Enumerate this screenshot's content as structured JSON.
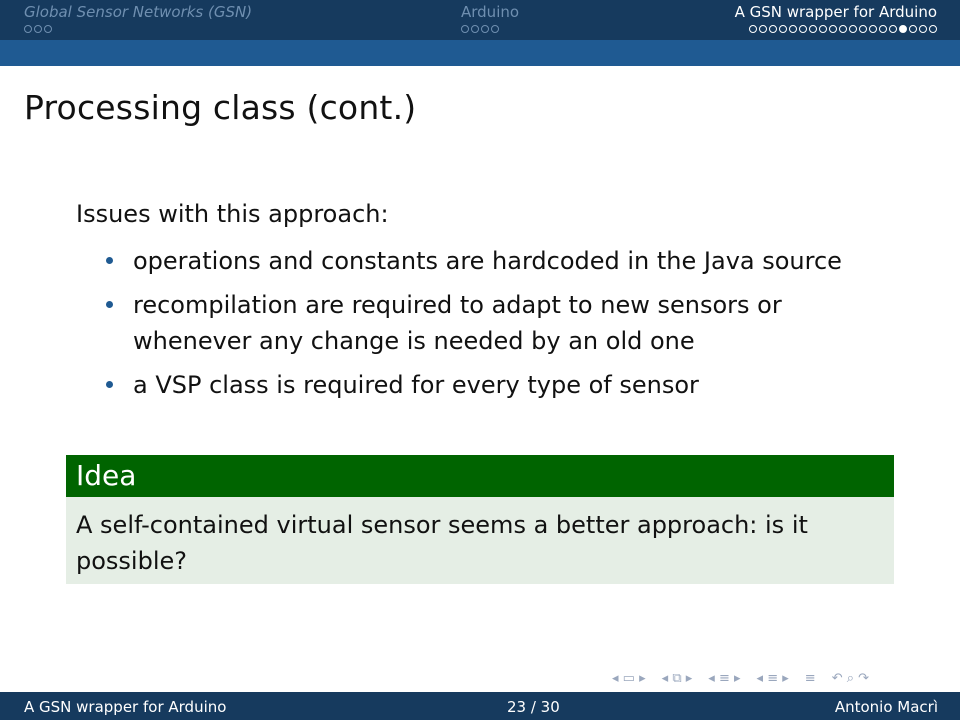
{
  "header": {
    "sections": [
      {
        "title": "Global Sensor Networks (GSN)",
        "dots": 3,
        "active_dot": -1,
        "current": false
      },
      {
        "title": "Arduino",
        "dots": 4,
        "active_dot": -1,
        "current": false
      },
      {
        "title": "A GSN wrapper for Arduino",
        "dots": 19,
        "active_dot": 15,
        "current": true
      }
    ]
  },
  "slide": {
    "title": "Processing class (cont.)",
    "issues_heading": "Issues with this approach:",
    "issues": [
      "operations and constants are hardcoded in the Java source",
      "recompilation are required to adapt to new sensors or whenever any change is needed by an old one",
      "a VSP class is required for every type of sensor"
    ],
    "idea": {
      "title": "Idea",
      "text": "A self-contained virtual sensor seems a better approach: is it possible?"
    }
  },
  "footer": {
    "left": "A GSN wrapper for Arduino",
    "center": "23 / 30",
    "right": "Antonio Macrì"
  },
  "colors": {
    "header_dark": "#163a5e",
    "header_band": "#1f5a92",
    "block_title": "#006400",
    "block_body": "#e5eee5"
  }
}
